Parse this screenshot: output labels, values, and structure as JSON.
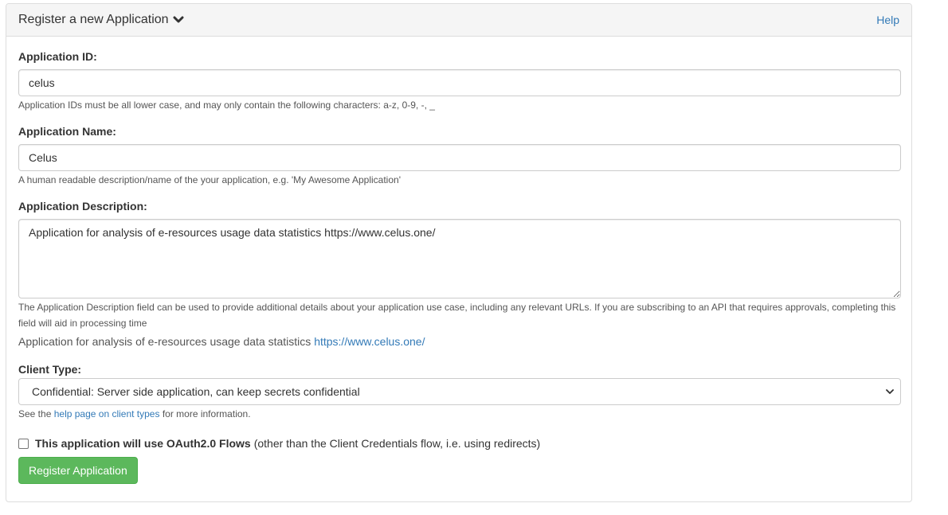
{
  "panel": {
    "title": "Register a new Application",
    "help_link": "Help"
  },
  "form": {
    "app_id": {
      "label": "Application ID:",
      "value": "celus",
      "help": "Application IDs must be all lower case, and may only contain the following characters: a-z, 0-9, -, _"
    },
    "app_name": {
      "label": "Application Name:",
      "value": "Celus",
      "help": "A human readable description/name of the your application, e.g. 'My Awesome Application'"
    },
    "app_description": {
      "label": "Application Description:",
      "value": "Application for analysis of e-resources usage data statistics https://www.celus.one/",
      "help": "The Application Description field can be used to provide additional details about your application use case, including any relevant URLs. If you are subscribing to an API that requires approvals, completing this field will aid in processing time",
      "preview_text": "Application for analysis of e-resources usage data statistics",
      "preview_link": "https://www.celus.one/"
    },
    "client_type": {
      "label": "Client Type:",
      "selected": "Confidential: Server side application, can keep secrets confidential",
      "help_prefix": "See the",
      "help_link": "help page on client types",
      "help_suffix": "for more information."
    },
    "oauth_checkbox": {
      "bold_label": "This application will use OAuth2.0 Flows",
      "extra_label": "(other than the Client Credentials flow, i.e. using redirects)",
      "checked": false
    },
    "submit_label": "Register Application"
  },
  "colors": {
    "primary_link": "#337ab7",
    "success_button": "#5cb85c",
    "panel_heading_bg": "#f5f5f5",
    "border": "#dddddd"
  }
}
